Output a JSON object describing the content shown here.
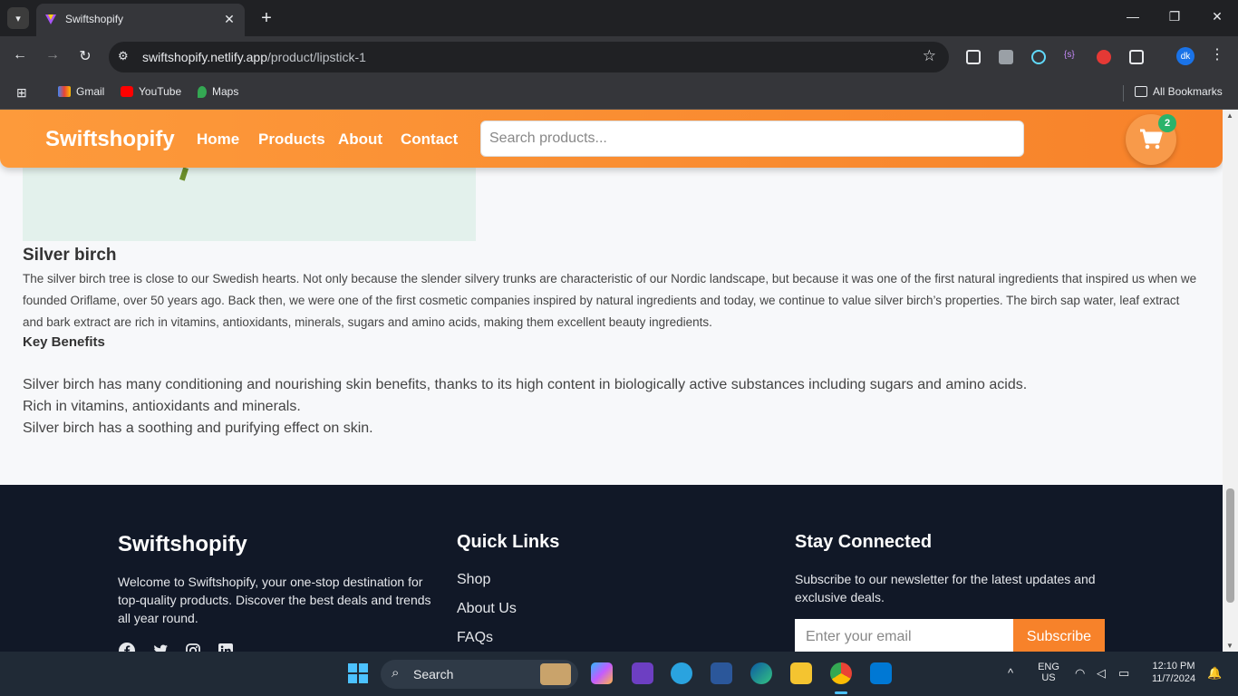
{
  "browser": {
    "tab_title": "Swiftshopify",
    "url_host": "swiftshopify.netlify.app",
    "url_path": "/product/lipstick-1",
    "profile_initials": "dk",
    "bookmarks": [
      "Gmail",
      "YouTube",
      "Maps"
    ],
    "all_bookmarks": "All Bookmarks"
  },
  "header": {
    "brand": "Swiftshopify",
    "nav": [
      "Home",
      "Products",
      "About",
      "Contact"
    ],
    "search_placeholder": "Search products...",
    "cart_count": "2"
  },
  "product": {
    "section_title": "Silver birch",
    "description": "The silver birch tree is close to our Swedish hearts. Not only because the slender silvery trunks are characteristic of our Nordic landscape, but because it was one of the first natural ingredients that inspired us when we founded Oriflame, over 50 years ago. Back then, we were one of the first cosmetic companies inspired by natural ingredients and today, we continue to value silver birch’s properties. The birch sap water, leaf extract and bark extract are rich in vitamins, antioxidants, minerals, sugars and amino acids, making them excellent beauty ingredients.",
    "key_benefits_title": "Key Benefits",
    "benefits": [
      "Silver birch has many conditioning and nourishing skin benefits, thanks to its high content in biologically active substances including sugars and amino acids.",
      "Rich in vitamins, antioxidants and minerals.",
      "Silver birch has a soothing and purifying effect on skin."
    ]
  },
  "footer": {
    "brand": "Swiftshopify",
    "description": "Welcome to Swiftshopify, your one-stop destination for top-quality products. Discover the best deals and trends all year round.",
    "quick_links_title": "Quick Links",
    "quick_links": [
      "Shop",
      "About Us",
      "FAQs"
    ],
    "stay_connected_title": "Stay Connected",
    "newsletter_text": "Subscribe to our newsletter for the latest updates and exclusive deals.",
    "email_placeholder": "Enter your email",
    "subscribe_label": "Subscribe",
    "social_icons": [
      "facebook-icon",
      "twitter-icon",
      "instagram-icon",
      "linkedin-icon"
    ]
  },
  "taskbar": {
    "search_label": "Search",
    "lang": "ENG",
    "region": "US",
    "time": "12:10 PM",
    "date": "11/7/2024"
  },
  "colors": {
    "brand_orange": "#f7822a",
    "footer_bg": "#111827",
    "badge_green": "#2ab36a"
  }
}
